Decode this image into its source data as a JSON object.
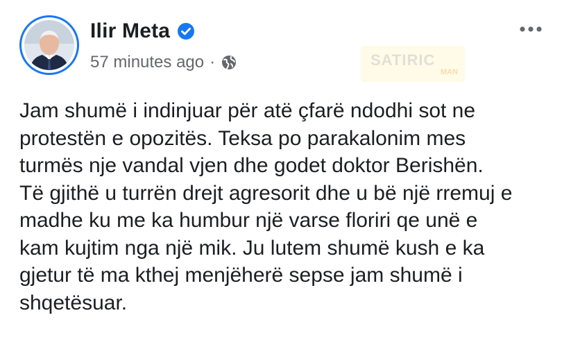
{
  "post": {
    "author": {
      "name": "Ilir Meta",
      "verified": true,
      "avatar_icon": "profile-photo"
    },
    "timestamp": "57 minutes ago",
    "separator": "·",
    "audience_icon": "globe-icon",
    "more_icon": "more-options-icon",
    "watermark": {
      "text": "SATIRIC",
      "sub": "MAN"
    },
    "text": "Jam shumë i indinjuar për atë çfarë ndodhi sot ne\nprotestën e opozitës. Teksa po parakalonim mes\nturmës nje vandal vjen dhe godet doktor Berishën.\nTë gjithë u turrën drejt agresorit dhe u bë një rremuj e\nmadhe ku me ka humbur një varse floriri qe unë e\nkam kujtim nga një mik. Ju lutem shumë kush e ka\ngjetur të ma kthej menjëherë sepse jam shumë i\nshqetësuar."
  },
  "colors": {
    "verified_blue": "#1877f2",
    "text_primary": "#1c1e21",
    "text_secondary": "#65676b"
  }
}
